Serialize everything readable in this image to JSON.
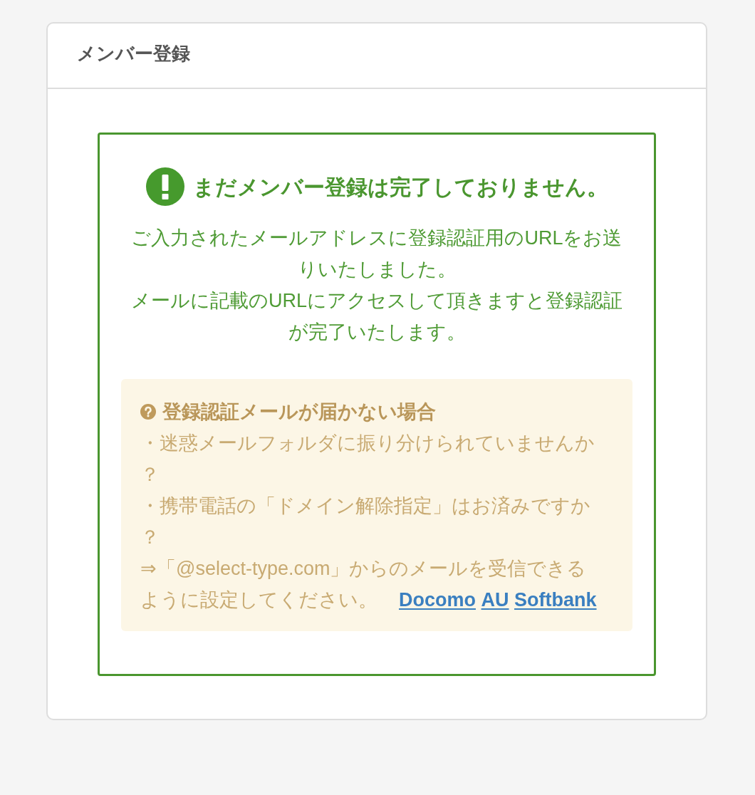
{
  "header": {
    "title": "メンバー登録"
  },
  "notice": {
    "heading": "まだメンバー登録は完了しておりません。",
    "message": [
      "ご入力されたメールアドレスに登録認証用のURLをお送りいたしました。",
      "メールに記載のURLにアクセスして頂きますと登録認証が完了いたします。"
    ]
  },
  "help": {
    "heading": "登録認証メールが届かない場合",
    "items": [
      "・迷惑メールフォルダに振り分けられていませんか？",
      "・携帯電話の「ドメイン解除指定」はお済みですか？"
    ],
    "instruction": "⇒「@select-type.com」からのメールを受信できるように設定してください。",
    "links": [
      "Docomo",
      "AU",
      "Softbank"
    ]
  }
}
